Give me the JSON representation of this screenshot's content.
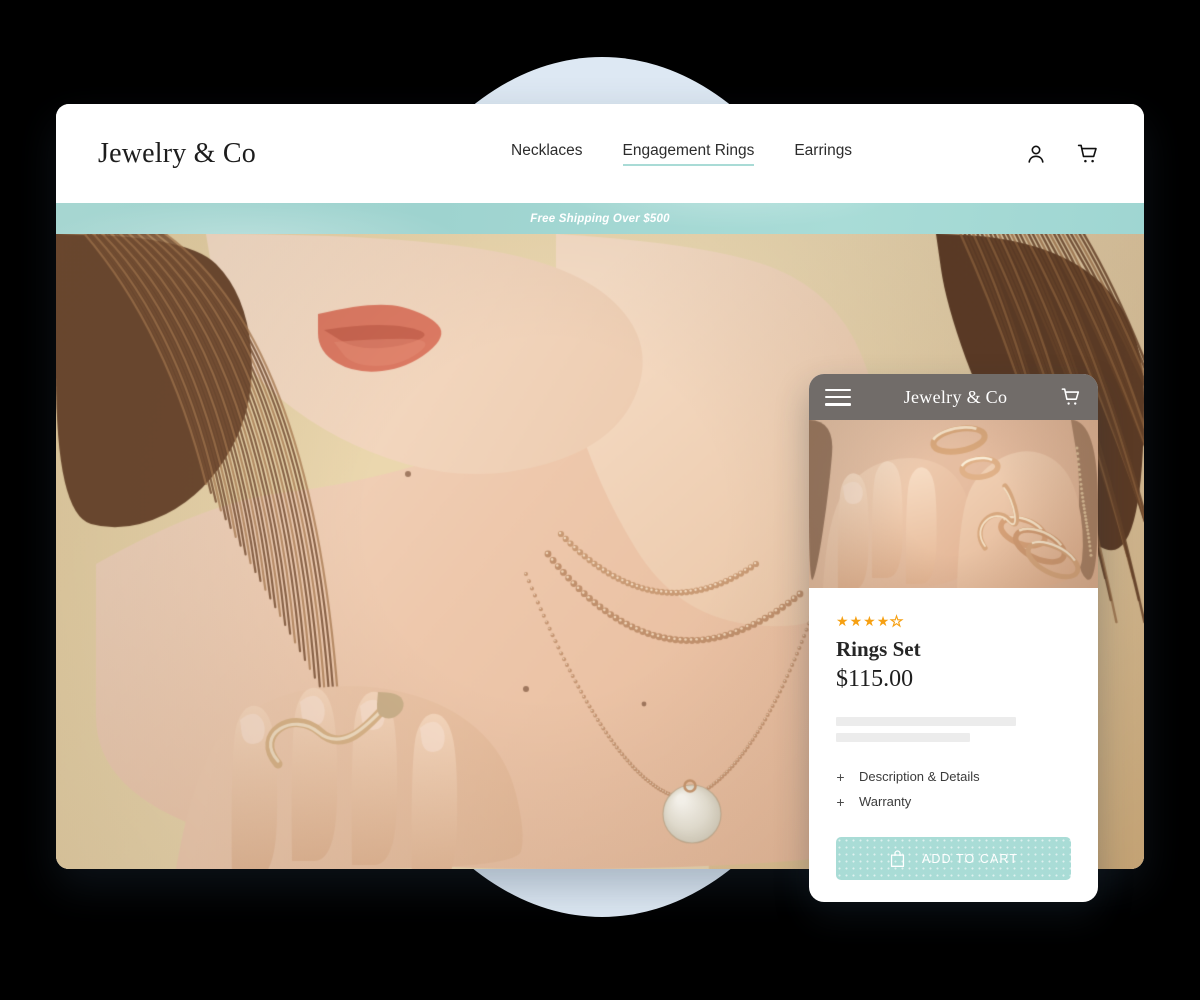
{
  "desktop": {
    "brand": "Jewelry & Co",
    "nav": [
      {
        "label": "Necklaces",
        "active": false
      },
      {
        "label": "Engagement Rings",
        "active": true
      },
      {
        "label": "Earrings",
        "active": false
      }
    ],
    "icons": {
      "account": "account-icon",
      "cart": "cart-icon"
    },
    "announcement": "Free Shipping Over $500",
    "hero_alt": "Woman wearing layered gold necklaces and a snake ring"
  },
  "mobile": {
    "brand": "Jewelry & Co",
    "icons": {
      "menu": "hamburger-icon",
      "cart": "cart-icon",
      "bag": "shopping-bag-icon"
    },
    "photo_alt": "Hands wearing a set of gold rings",
    "rating": {
      "value": 4,
      "max": 5,
      "filled": "★",
      "empty": "★"
    },
    "product_title": "Rings Set",
    "price": "$115.00",
    "accordions": [
      {
        "toggle": "+",
        "label": "Description & Details"
      },
      {
        "toggle": "+",
        "label": "Warranty"
      }
    ],
    "add_to_cart_label": "ADD TO CART"
  },
  "colors": {
    "background": "#000000",
    "circle": "#dde8f3",
    "mint": "#a9dcd6",
    "announcement_bar": "#9fd4d0",
    "star": "#f6a012",
    "mobile_header_overlay": "rgba(78,71,68,0.80)",
    "placeholder": "#ececec"
  }
}
